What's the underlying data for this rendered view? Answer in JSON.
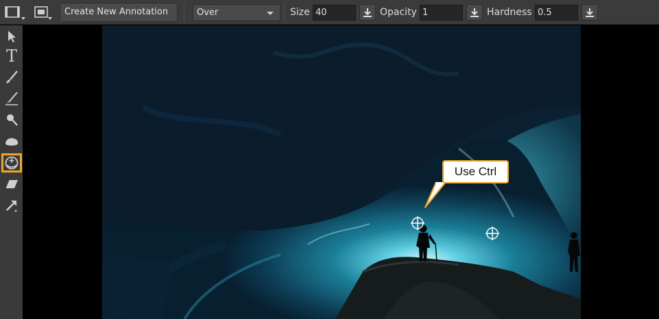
{
  "toolbar": {
    "create_annotation_label": "Create New Annotation",
    "blend_mode": "Over",
    "size_label": "Size",
    "size_value": "40",
    "opacity_label": "Opacity",
    "opacity_value": "1",
    "hardness_label": "Hardness",
    "hardness_value": "0.5"
  },
  "tools": {
    "text_tool_glyph": "T"
  },
  "callout": {
    "text": "Use Ctrl"
  },
  "colors": {
    "accent": "#f2a525",
    "panel": "#3b3b3b",
    "field": "#262626"
  }
}
